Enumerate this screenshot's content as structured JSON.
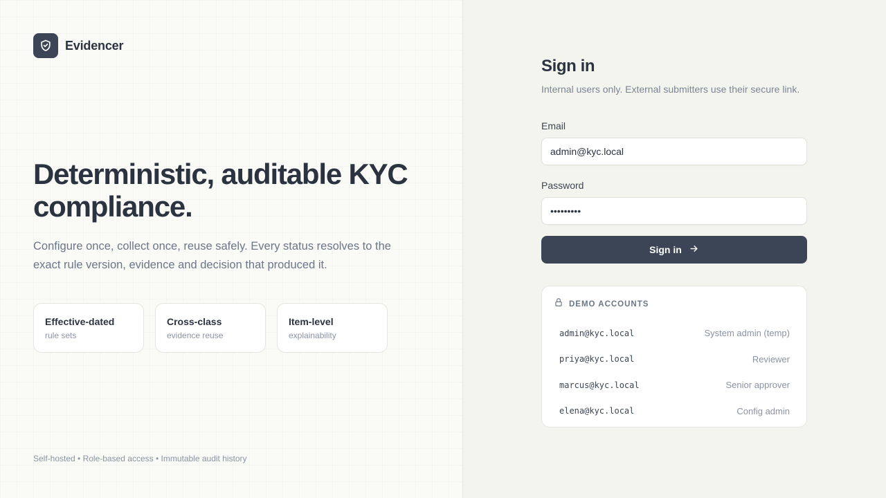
{
  "brand": {
    "name": "Evidencer"
  },
  "hero": {
    "title": "Deterministic, auditable KYC compliance.",
    "subtitle": "Configure once, collect once, reuse safely. Every status resolves to the exact rule version, evidence and decision that produced it."
  },
  "features": [
    {
      "title": "Effective-dated",
      "subtitle": "rule sets"
    },
    {
      "title": "Cross-class",
      "subtitle": "evidence reuse"
    },
    {
      "title": "Item-level",
      "subtitle": "explainability"
    }
  ],
  "footer": {
    "note": "Self-hosted • Role-based access • Immutable audit history"
  },
  "signin": {
    "title": "Sign in",
    "subtitle": "Internal users only. External submitters use their secure link.",
    "email_label": "Email",
    "email_value": "admin@kyc.local",
    "password_label": "Password",
    "password_value": "password1",
    "button_label": "Sign in"
  },
  "demo": {
    "title": "DEMO ACCOUNTS",
    "accounts": [
      {
        "email": "admin@kyc.local",
        "role": "System admin (temp)"
      },
      {
        "email": "priya@kyc.local",
        "role": "Reviewer"
      },
      {
        "email": "marcus@kyc.local",
        "role": "Senior approver"
      },
      {
        "email": "elena@kyc.local",
        "role": "Config admin"
      }
    ]
  },
  "colors": {
    "accent": "#3b4556",
    "text": "#2b3340",
    "muted": "#8a93a2"
  },
  "icons": {
    "brand": "shield-check-icon",
    "button": "arrow-right-icon",
    "demo": "lock-icon"
  }
}
